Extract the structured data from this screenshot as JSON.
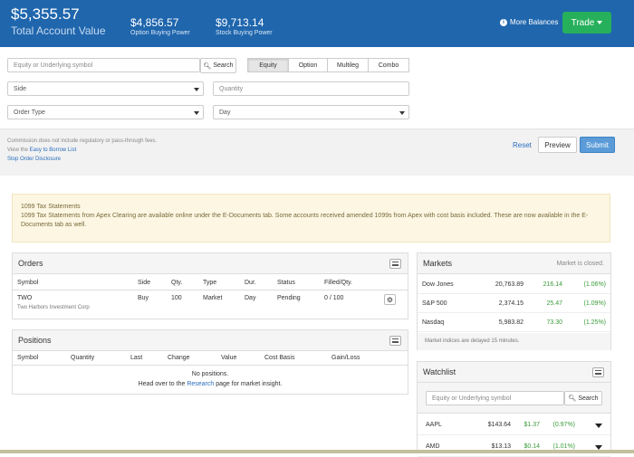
{
  "header": {
    "total_value": "$5,355.57",
    "total_label": "Total Account Value",
    "option_bp": "$4,856.57",
    "option_bp_label": "Option Buying Power",
    "stock_bp": "$9,713.14",
    "stock_bp_label": "Stock Buying Power",
    "more_balances": "More Balances",
    "trade": "Trade"
  },
  "order_form": {
    "symbol_placeholder": "Equity or Underlying symbol",
    "search": "Search",
    "tabs": [
      "Equity",
      "Option",
      "Multileg",
      "Combo"
    ],
    "active_tab": "Equity",
    "side": "Side",
    "quantity_placeholder": "Quantity",
    "order_type": "Order Type",
    "duration": "Day"
  },
  "notes": {
    "commission": "Commission does not include regulatory or pass-through fees.",
    "view_prefix": "View the ",
    "easy_to_borrow": "Easy to Borrow List",
    "stop_order": "Stop Order Disclosure"
  },
  "actions": {
    "reset": "Reset",
    "preview": "Preview",
    "submit": "Submit"
  },
  "alert": {
    "title": "1099 Tax Statements",
    "body": "1099 Tax Statements from Apex Clearing are available online under the E-Documents tab. Some accounts received amended 1099s from Apex with cost basis included. These are now available in the E-Documents tab as well."
  },
  "orders": {
    "title": "Orders",
    "columns": [
      "Symbol",
      "Side",
      "Qty.",
      "Type",
      "Dur.",
      "Status",
      "Filled/Qty."
    ],
    "rows": [
      {
        "symbol": "TWO",
        "name": "Two Harbors Investment Corp",
        "side": "Buy",
        "qty": "100",
        "type": "Market",
        "dur": "Day",
        "status": "Pending",
        "filled": "0 / 100"
      }
    ]
  },
  "positions": {
    "title": "Positions",
    "columns": [
      "Symbol",
      "Quantity",
      "Last",
      "Change",
      "Value",
      "Cost Basis",
      "Gain/Loss"
    ],
    "empty": "No positions.",
    "hint_prefix": "Head over to the ",
    "hint_link": "Research",
    "hint_suffix": " page for market insight."
  },
  "markets": {
    "title": "Markets",
    "status": "Market is closed.",
    "rows": [
      {
        "name": "Dow Jones",
        "value": "20,763.89",
        "change": "216.14",
        "pct": "(1.06%)"
      },
      {
        "name": "S&P 500",
        "value": "2,374.15",
        "change": "25.47",
        "pct": "(1.09%)"
      },
      {
        "name": "Nasdaq",
        "value": "5,983.82",
        "change": "73.30",
        "pct": "(1.25%)"
      }
    ],
    "footnote": "Market indices are delayed 15 minutes."
  },
  "watchlist": {
    "title": "Watchlist",
    "placeholder": "Equity or Underlying symbol",
    "search": "Search",
    "rows": [
      {
        "symbol": "AAPL",
        "price": "$143.64",
        "change": "$1.37",
        "pct": "(0.97%)"
      },
      {
        "symbol": "AMD",
        "price": "$13.13",
        "change": "$0.14",
        "pct": "(1.01%)"
      }
    ]
  },
  "colors": {
    "header": "#1f66ad",
    "trade": "#27b05b",
    "submit": "#5a9bd8",
    "positive": "#3a9b3a"
  }
}
